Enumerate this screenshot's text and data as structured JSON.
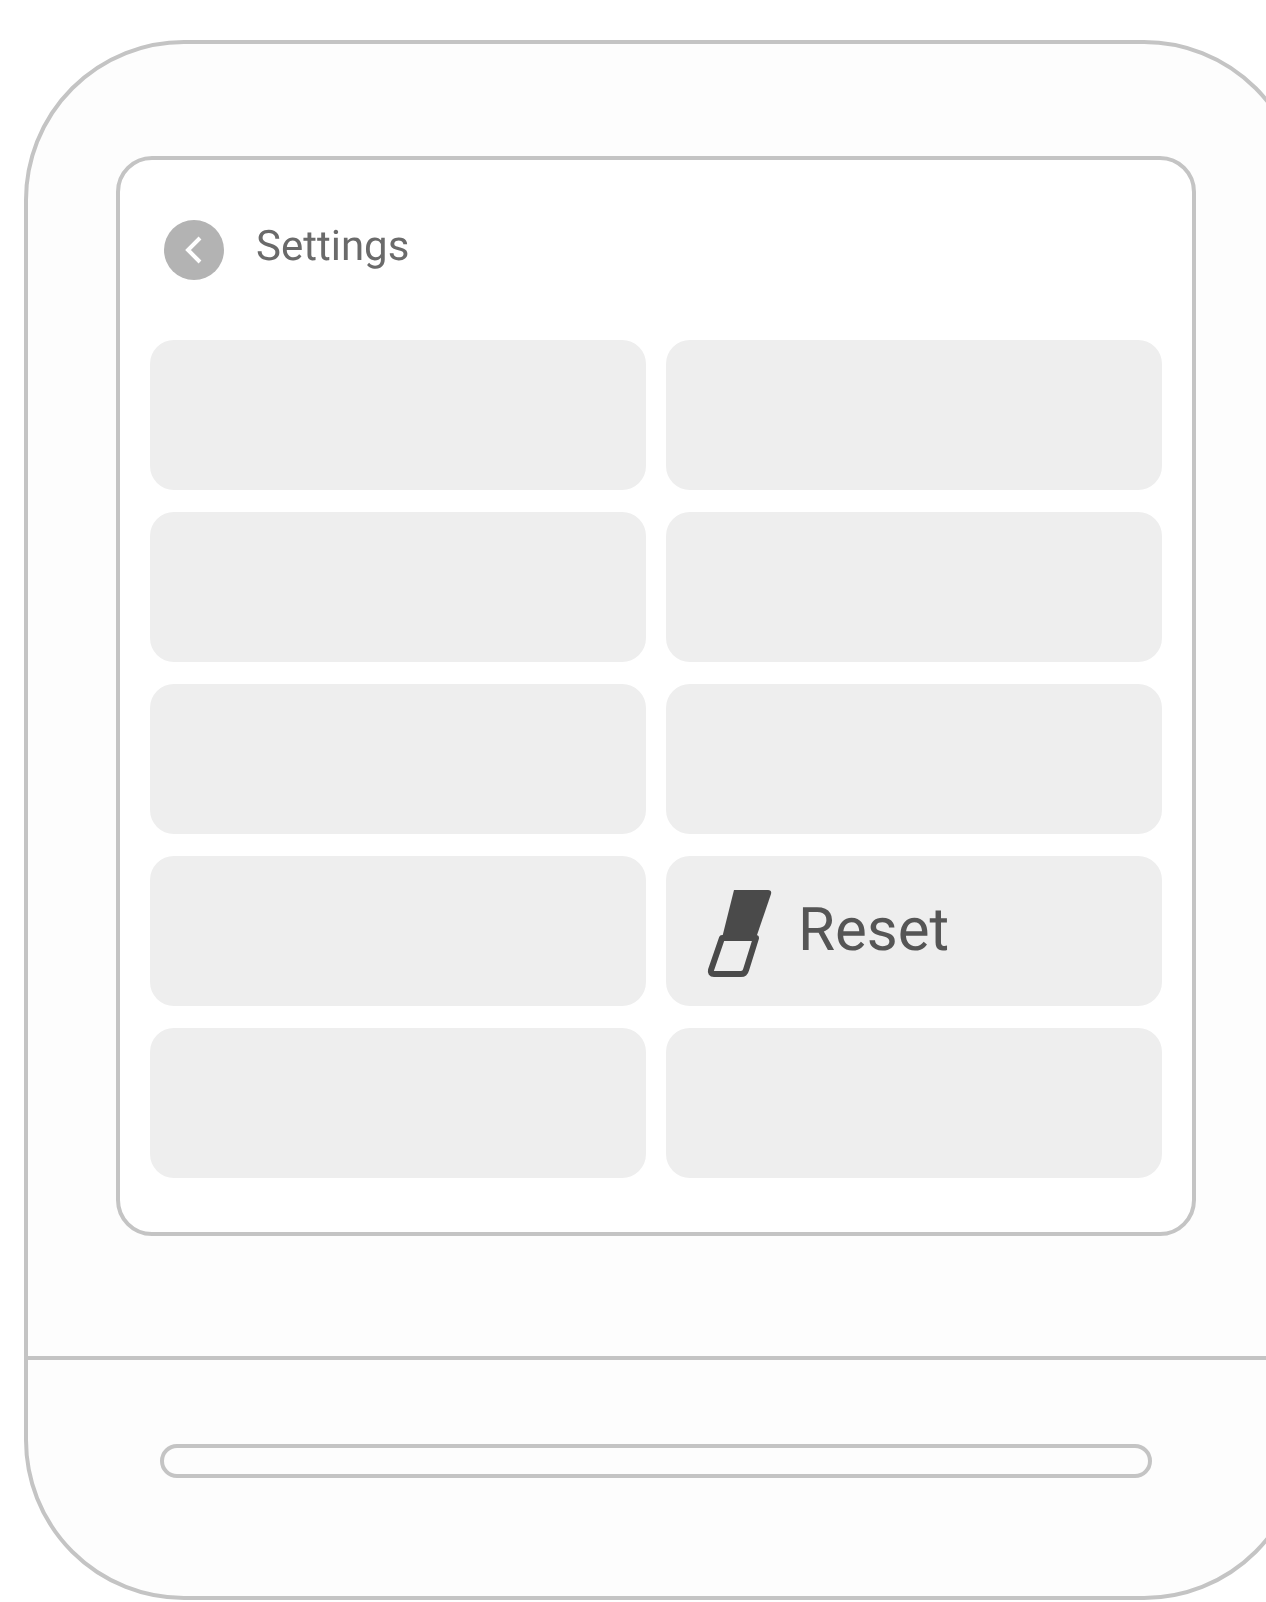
{
  "screen": {
    "title": "Settings"
  },
  "tiles": [
    {
      "kind": "blank"
    },
    {
      "kind": "blank"
    },
    {
      "kind": "blank"
    },
    {
      "kind": "blank"
    },
    {
      "kind": "blank"
    },
    {
      "kind": "blank"
    },
    {
      "kind": "blank"
    },
    {
      "kind": "action",
      "label": "Reset"
    },
    {
      "kind": "blank"
    },
    {
      "kind": "blank"
    }
  ]
}
